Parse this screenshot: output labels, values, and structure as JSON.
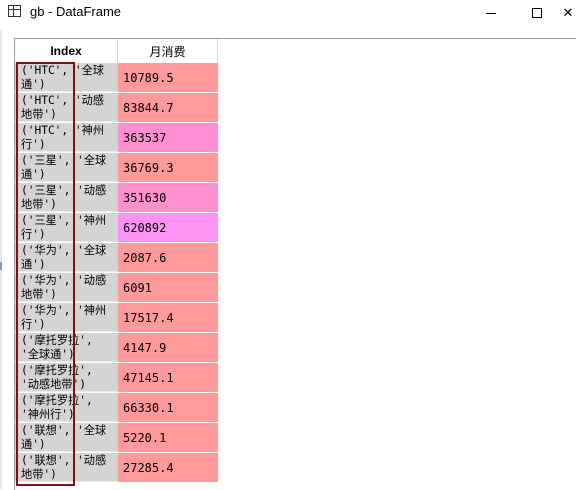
{
  "window": {
    "title": "gb - DataFrame",
    "close_glyph": "✕"
  },
  "table": {
    "index_header": "Index",
    "column_header": "月消费",
    "rows": [
      {
        "index_line1": "('HTC', '全球",
        "index_line2": "通')",
        "value": "10789.5",
        "color": "#ff9a9a"
      },
      {
        "index_line1": "('HTC', '动感",
        "index_line2": "地带')",
        "value": "83844.7",
        "color": "#ff9a9c"
      },
      {
        "index_line1": "('HTC', '神州",
        "index_line2": "行')",
        "value": "363537",
        "color": "#ff8fd0"
      },
      {
        "index_line1": "('三星', '全球",
        "index_line2": "通')",
        "value": "36769.3",
        "color": "#ff9a9a"
      },
      {
        "index_line1": "('三星', '动感",
        "index_line2": "地带')",
        "value": "351630",
        "color": "#ff90ce"
      },
      {
        "index_line1": "('三星', '神州",
        "index_line2": "行')",
        "value": "620892",
        "color": "#fb93f4"
      },
      {
        "index_line1": "('华为', '全球",
        "index_line2": "通')",
        "value": "2087.6",
        "color": "#ff9a9a"
      },
      {
        "index_line1": "('华为', '动感",
        "index_line2": "地带')",
        "value": "6091",
        "color": "#ff9a9a"
      },
      {
        "index_line1": "('华为', '神州",
        "index_line2": "行')",
        "value": "17517.4",
        "color": "#ff9a9a"
      },
      {
        "index_line1": "('摩托罗拉',",
        "index_line2": "'全球通')",
        "value": "4147.9",
        "color": "#ff9a9a"
      },
      {
        "index_line1": "('摩托罗拉',",
        "index_line2": "'动感地带')",
        "value": "47145.1",
        "color": "#ff9a9a"
      },
      {
        "index_line1": "('摩托罗拉',",
        "index_line2": "'神州行')",
        "value": "66330.1",
        "color": "#ff9a9c"
      },
      {
        "index_line1": "('联想', '全球",
        "index_line2": "通')",
        "value": "5220.1",
        "color": "#ff9a9a"
      },
      {
        "index_line1": "('联想', '动感",
        "index_line2": "地带')",
        "value": "27285.4",
        "color": "#ff9a9a"
      }
    ]
  }
}
